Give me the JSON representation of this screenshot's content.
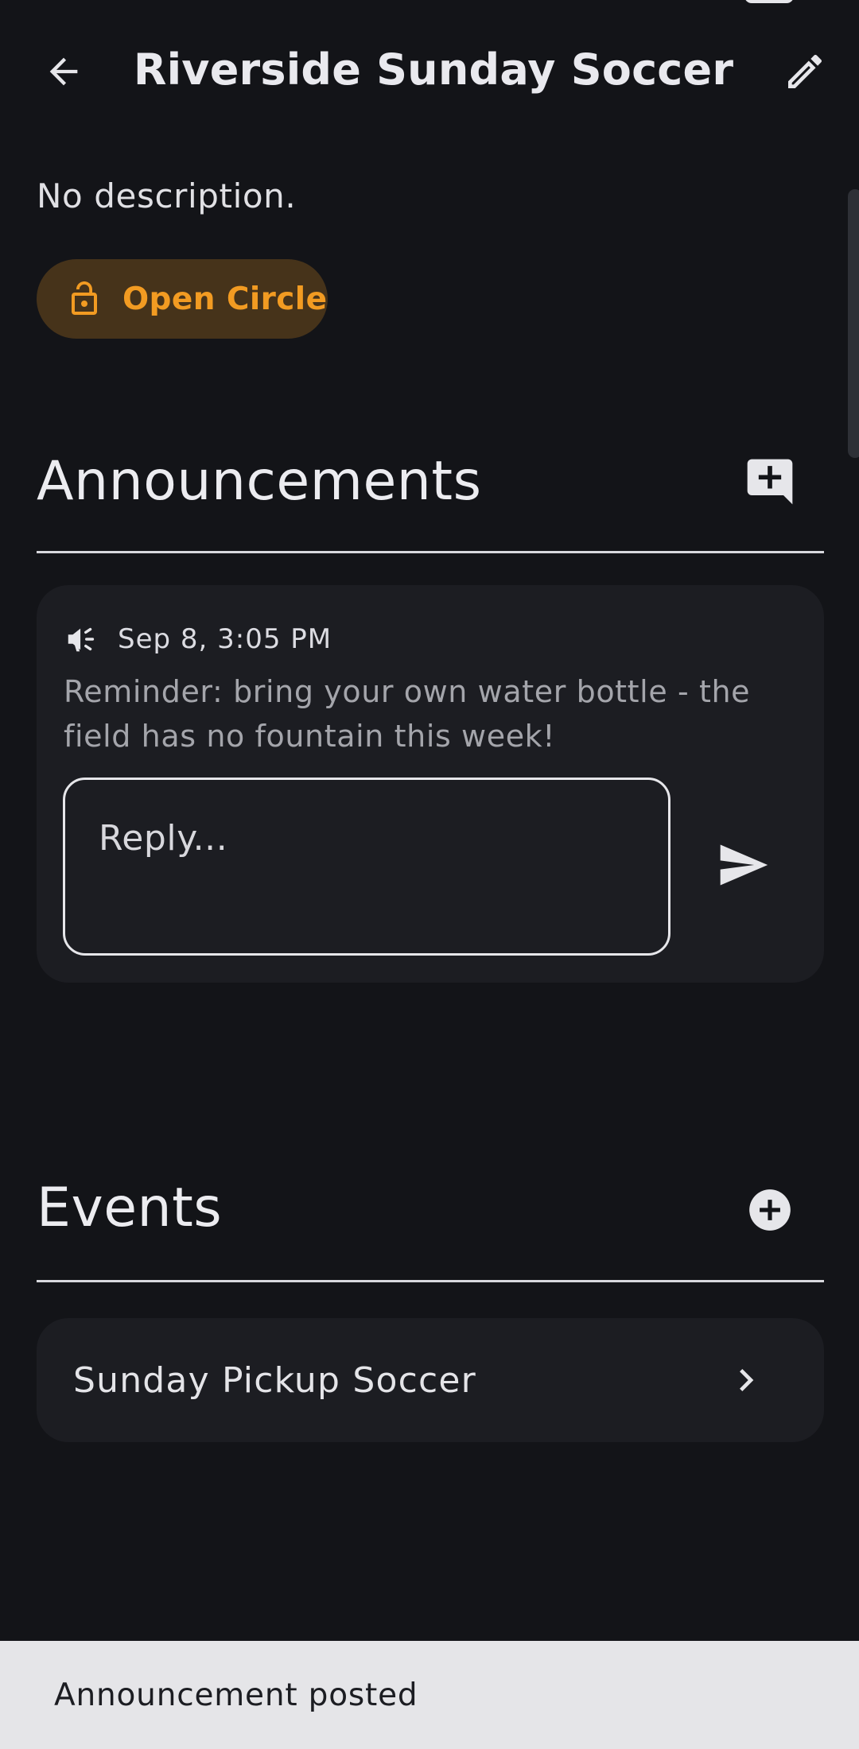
{
  "header": {
    "title": "Riverside Sunday Soccer",
    "back_icon": "arrow-back-icon",
    "edit_icon": "pencil-edit-icon"
  },
  "group": {
    "description": "No description.",
    "visibility_chip": {
      "label": "Open Circle",
      "icon": "lock-open-icon",
      "color": "#f29b22",
      "background": "#46331a"
    }
  },
  "announcements": {
    "title": "Announcements",
    "add_icon": "add-comment-icon",
    "items": [
      {
        "icon": "megaphone-icon",
        "timestamp": "Sep 8, 3:05 PM",
        "body": "Reminder: bring your own water bottle - the field has no fountain this week!",
        "reply_placeholder": "Reply...",
        "send_icon": "send-icon"
      }
    ]
  },
  "events": {
    "title": "Events",
    "add_icon": "add-circle-icon",
    "items": [
      {
        "label": "Sunday Pickup Soccer",
        "icon": "chevron-right-icon"
      }
    ]
  },
  "snackbar": {
    "message": "Announcement posted"
  },
  "theme": {
    "background": "#131418",
    "card": "#1c1d22",
    "text": "#e6e6ea",
    "muted_text": "#a4a5ab",
    "accent": "#f29b22"
  }
}
